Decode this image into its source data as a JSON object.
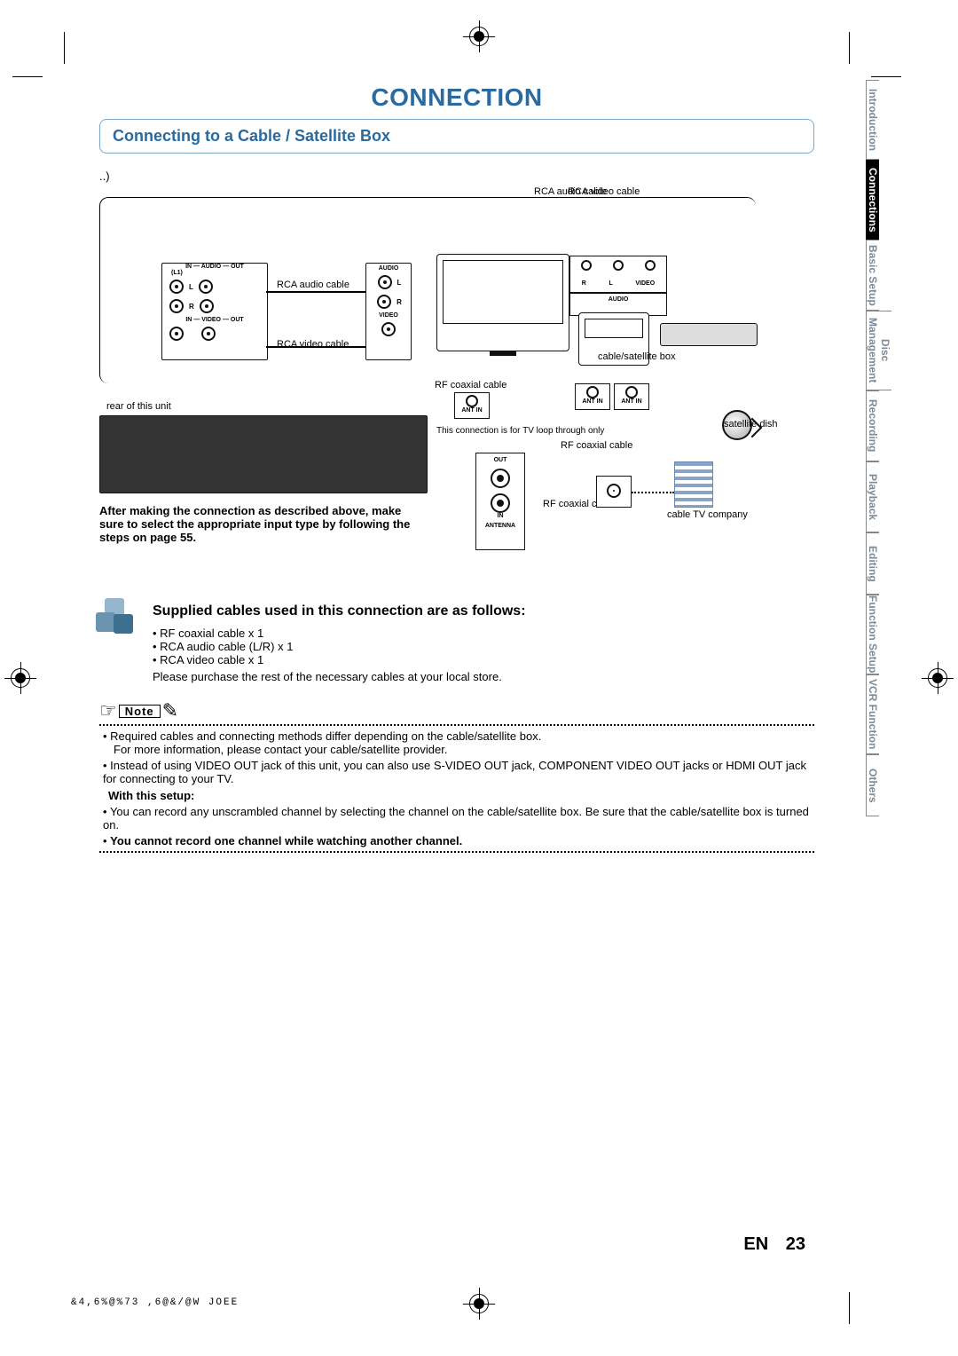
{
  "page": {
    "title": "CONNECTION",
    "section_title": "Connecting to a Cable / Satellite Box",
    "fragment": "..)",
    "lang": "EN",
    "number": "23"
  },
  "diagram": {
    "rca_video_cable": "RCA video cable",
    "rca_audio_cable": "RCA audio  cable",
    "rca_audio_cable2": "RCA audio cable",
    "rca_video_cable2": "RCA video cable",
    "rear_of_unit": "rear of this unit",
    "rf_coax_cable": "RF coaxial cable",
    "cable_satellite_box": "cable/satellite box",
    "satellite_dish": "satellite dish",
    "rf_coax_cable2": "RF coaxial cable",
    "rf_coax_cable_short": "RF coaxial cable",
    "cable_tv_company": "cable TV company",
    "loop_through": "This connection is for TV loop through only",
    "connection_note": "After making the connection as described above, make sure to select the appropriate input type by following the steps on page 55.",
    "unit_in_audio_out": "IN — AUDIO — OUT",
    "unit_in_video_out": "IN — VIDEO — OUT",
    "unit_l": "L",
    "unit_r": "R",
    "unit_l1": "(L1)",
    "tv_audio_in": "AUDIO",
    "tv_video_in": "VIDEO",
    "tv_r": "R",
    "tv_l": "L",
    "antenna": "ANTENNA",
    "out": "OUT",
    "in": "IN",
    "ant_in": "ANT IN",
    "audio2": "AUDIO",
    "video2": "VIDEO"
  },
  "supplied": {
    "heading": "Supplied cables used in this connection are as follows:",
    "items": [
      "RF coaxial cable x 1",
      "RCA audio cable (L/R) x 1",
      "RCA video cable x 1"
    ],
    "purchase": "Please purchase the rest of the necessary cables at your local store."
  },
  "note_icon": "Note",
  "notes": {
    "n1": "Required cables and connecting methods differ depending on the cable/satellite box.",
    "n1sub": "For more information, please contact your cable/satellite provider.",
    "n2": "Instead of using VIDEO OUT jack of this unit, you can also use S-VIDEO OUT jack, COMPONENT VIDEO OUT jacks or HDMI OUT jack for connecting to your TV.",
    "setup_heading": "With this setup:",
    "n3": "You can record any unscrambled channel by selecting the channel on the cable/satellite box. Be sure that the cable/satellite box is turned on.",
    "n4": "You cannot record one channel while watching another channel."
  },
  "tabs": {
    "t1": "Introduction",
    "t2": "Connections",
    "t3": "Basic Setup",
    "t4": "Disc Management",
    "t5": "Recording",
    "t6": "Playback",
    "t7": "Editing",
    "t8": "Function Setup",
    "t9": "VCR Function",
    "t10": "Others"
  },
  "print_meta": "&4,6%@%73  ,6@&/@W  JOEE"
}
